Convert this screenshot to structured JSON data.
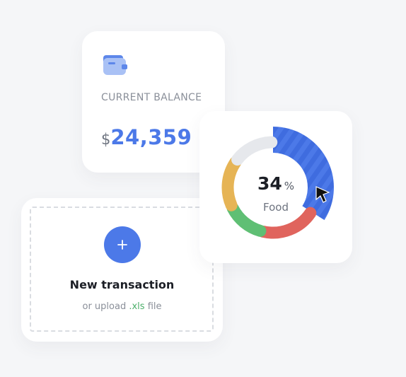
{
  "balance_card": {
    "icon": "wallet-icon",
    "label": "CURRENT BALANCE",
    "currency": "$",
    "amount": "24,359",
    "accent_color": "#4c79e8"
  },
  "transaction_card": {
    "icon": "plus-icon",
    "title": "New transaction",
    "subtitle_prefix": "or upload ",
    "subtitle_ext": ".xls",
    "subtitle_suffix": " file"
  },
  "spending_chart": {
    "percent_value": "34",
    "percent_unit": "%",
    "category": "Food",
    "cursor_icon": "pointer-cursor-icon"
  },
  "chart_data": {
    "type": "pie",
    "variant": "donut",
    "title": "",
    "center_label": "34% Food",
    "slices": [
      {
        "name": "Food",
        "fraction": 0.34,
        "color": "#4c79e8",
        "highlighted": true
      },
      {
        "name": "",
        "fraction": 0.2,
        "color": "#e0645d"
      },
      {
        "name": "",
        "fraction": 0.14,
        "color": "#5fbf74"
      },
      {
        "name": "",
        "fraction": 0.17,
        "color": "#e6b455"
      },
      {
        "name": "",
        "fraction": 0.15,
        "color": "#e6e8ec"
      }
    ]
  }
}
